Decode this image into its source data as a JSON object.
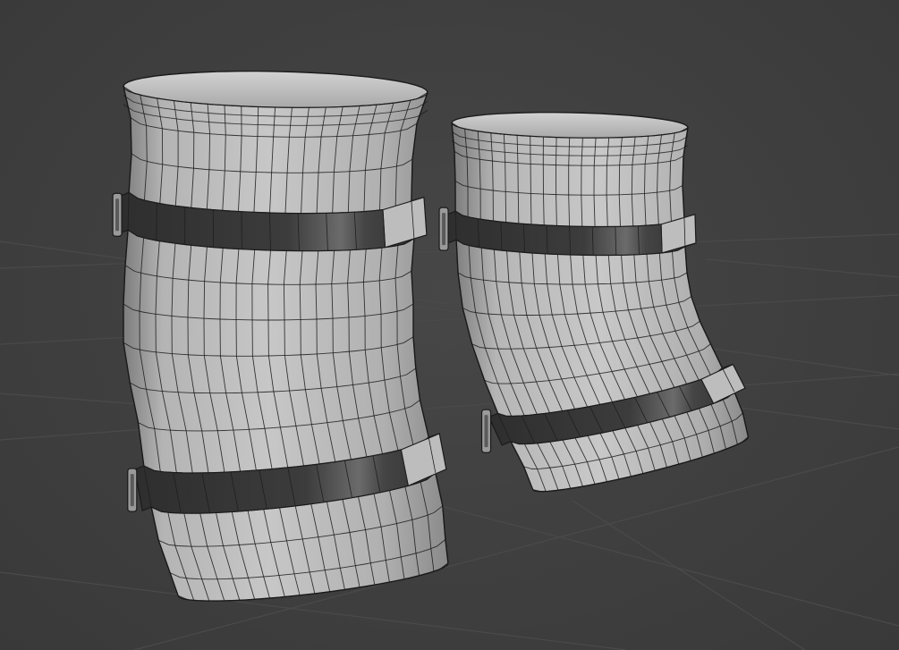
{
  "viewport": {
    "background_color": "#3d3d3d",
    "grid_color": "#4a4a4a",
    "mesh_fill_color": "#bcbcbc",
    "mesh_shade_color": "#8f8f8f",
    "wire_color": "#1a1a1a",
    "strap_color": "#3a3a3a",
    "strap_highlight_color": "#6a6a6a",
    "buckle_color": "#9a9a9a"
  },
  "objects": [
    {
      "name": "knee-pad-left",
      "type": "mesh"
    },
    {
      "name": "knee-pad-right",
      "type": "mesh"
    }
  ]
}
